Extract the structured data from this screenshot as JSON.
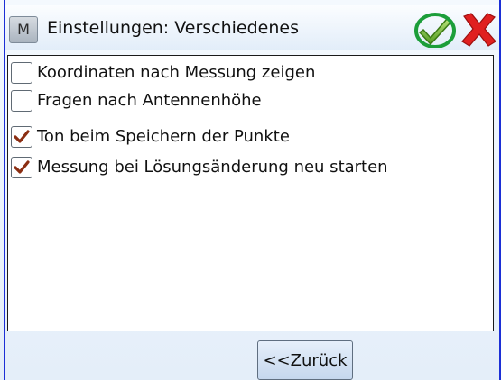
{
  "window": {
    "title": "Einstellungen: Verschiedenes",
    "menu_button_label": "M",
    "ok_icon": "checkmark-icon",
    "cancel_icon": "close-icon",
    "highlight_color": "#1c9e3a"
  },
  "options": [
    {
      "label": "Koordinaten nach Messung zeigen",
      "checked": false
    },
    {
      "label": "Fragen nach Antennenhöhe",
      "checked": false
    },
    {
      "label": "Ton beim Speichern der Punkte",
      "checked": true
    },
    {
      "label": "Messung bei Lösungsänderung neu starten",
      "checked": true
    }
  ],
  "footer": {
    "back_prefix": "<<",
    "back_mnemonic": "Z",
    "back_rest": "urück"
  }
}
